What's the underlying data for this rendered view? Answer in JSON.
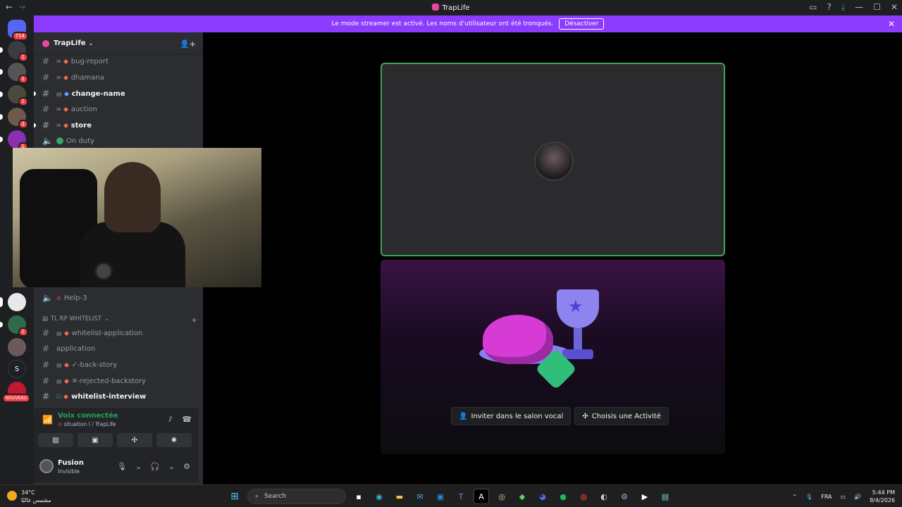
{
  "window": {
    "title": "TrapLife"
  },
  "banner": {
    "text": "Le mode streamer est activé. Les noms d'utilisateur ont été tronqués.",
    "button": "Désactiver"
  },
  "guilds": {
    "home_badge": "714",
    "items": [
      {
        "badge": "1"
      },
      {
        "badge": "1"
      },
      {
        "badge": "1"
      },
      {
        "badge": "2"
      },
      {
        "badge": "1"
      }
    ],
    "lower_items": [
      {
        "badge": ""
      },
      {
        "badge": "1"
      },
      {
        "badge": ""
      },
      {
        "label": "S"
      },
      {
        "badge": "NOUVEAU"
      }
    ]
  },
  "server": {
    "name": "TrapLife"
  },
  "channels": [
    {
      "name": "bug-report",
      "unread": false
    },
    {
      "name": "dhamana",
      "unread": false
    },
    {
      "name": "change-name",
      "unread": true
    },
    {
      "name": "auction",
      "unread": false
    },
    {
      "name": "store",
      "unread": true
    },
    {
      "name": "On duty",
      "unread": false
    }
  ],
  "lower_channels": {
    "help3": "Help-3",
    "category": "TL RP WHITELIST",
    "items": [
      {
        "name": "whitelist-application",
        "unread": false
      },
      {
        "name": "application",
        "unread": false
      },
      {
        "name": "✓-back-story",
        "unread": false
      },
      {
        "name": "✕-rejected-backstory",
        "unread": false
      },
      {
        "name": "whitelist-interview",
        "unread": true
      }
    ]
  },
  "voice": {
    "title": "Voix connectée",
    "subtitle": "situation l / TrapLife"
  },
  "user": {
    "name": "Fusion",
    "status": "Invisible"
  },
  "activity": {
    "invite": "Inviter dans le salon vocal",
    "activity": "Choisis une Activité"
  },
  "taskbar": {
    "temp": "34°C",
    "weather_desc": "مشمس غالبًا",
    "search": "Search",
    "lang": "FRA",
    "time": "5:44 PM",
    "date": "8/4/2026"
  },
  "colors": {
    "banner": "#8c3cff",
    "voice_green": "#23a55a",
    "speaking_border": "#3ba55d"
  }
}
